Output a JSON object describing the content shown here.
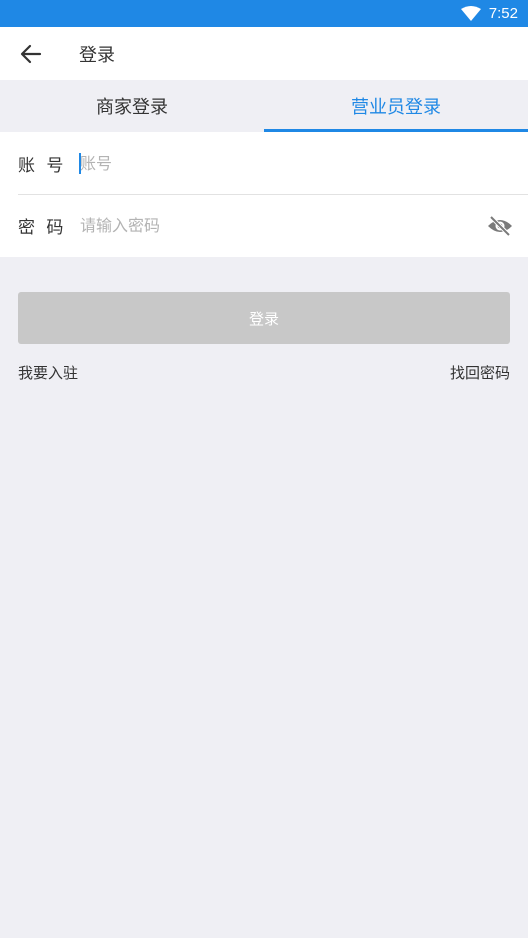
{
  "status_bar": {
    "time": "7:52",
    "wifi_icon": "wifi-icon"
  },
  "app_bar": {
    "back_icon": "arrow-left-icon",
    "title": "登录"
  },
  "tabs": [
    {
      "label": "商家登录",
      "active": false
    },
    {
      "label": "营业员登录",
      "active": true
    }
  ],
  "form": {
    "account": {
      "label": "账 号",
      "value": "",
      "placeholder": "账号"
    },
    "password": {
      "label": "密 码",
      "value": "",
      "placeholder": "请输入密码",
      "visibility_icon": "eye-off-icon"
    }
  },
  "login_button": {
    "label": "登录"
  },
  "links": {
    "register": "我要入驻",
    "forgot_password": "找回密码"
  },
  "colors": {
    "primary": "#1f88e5",
    "background": "#efeff4",
    "button_disabled": "#c8c8c8"
  }
}
